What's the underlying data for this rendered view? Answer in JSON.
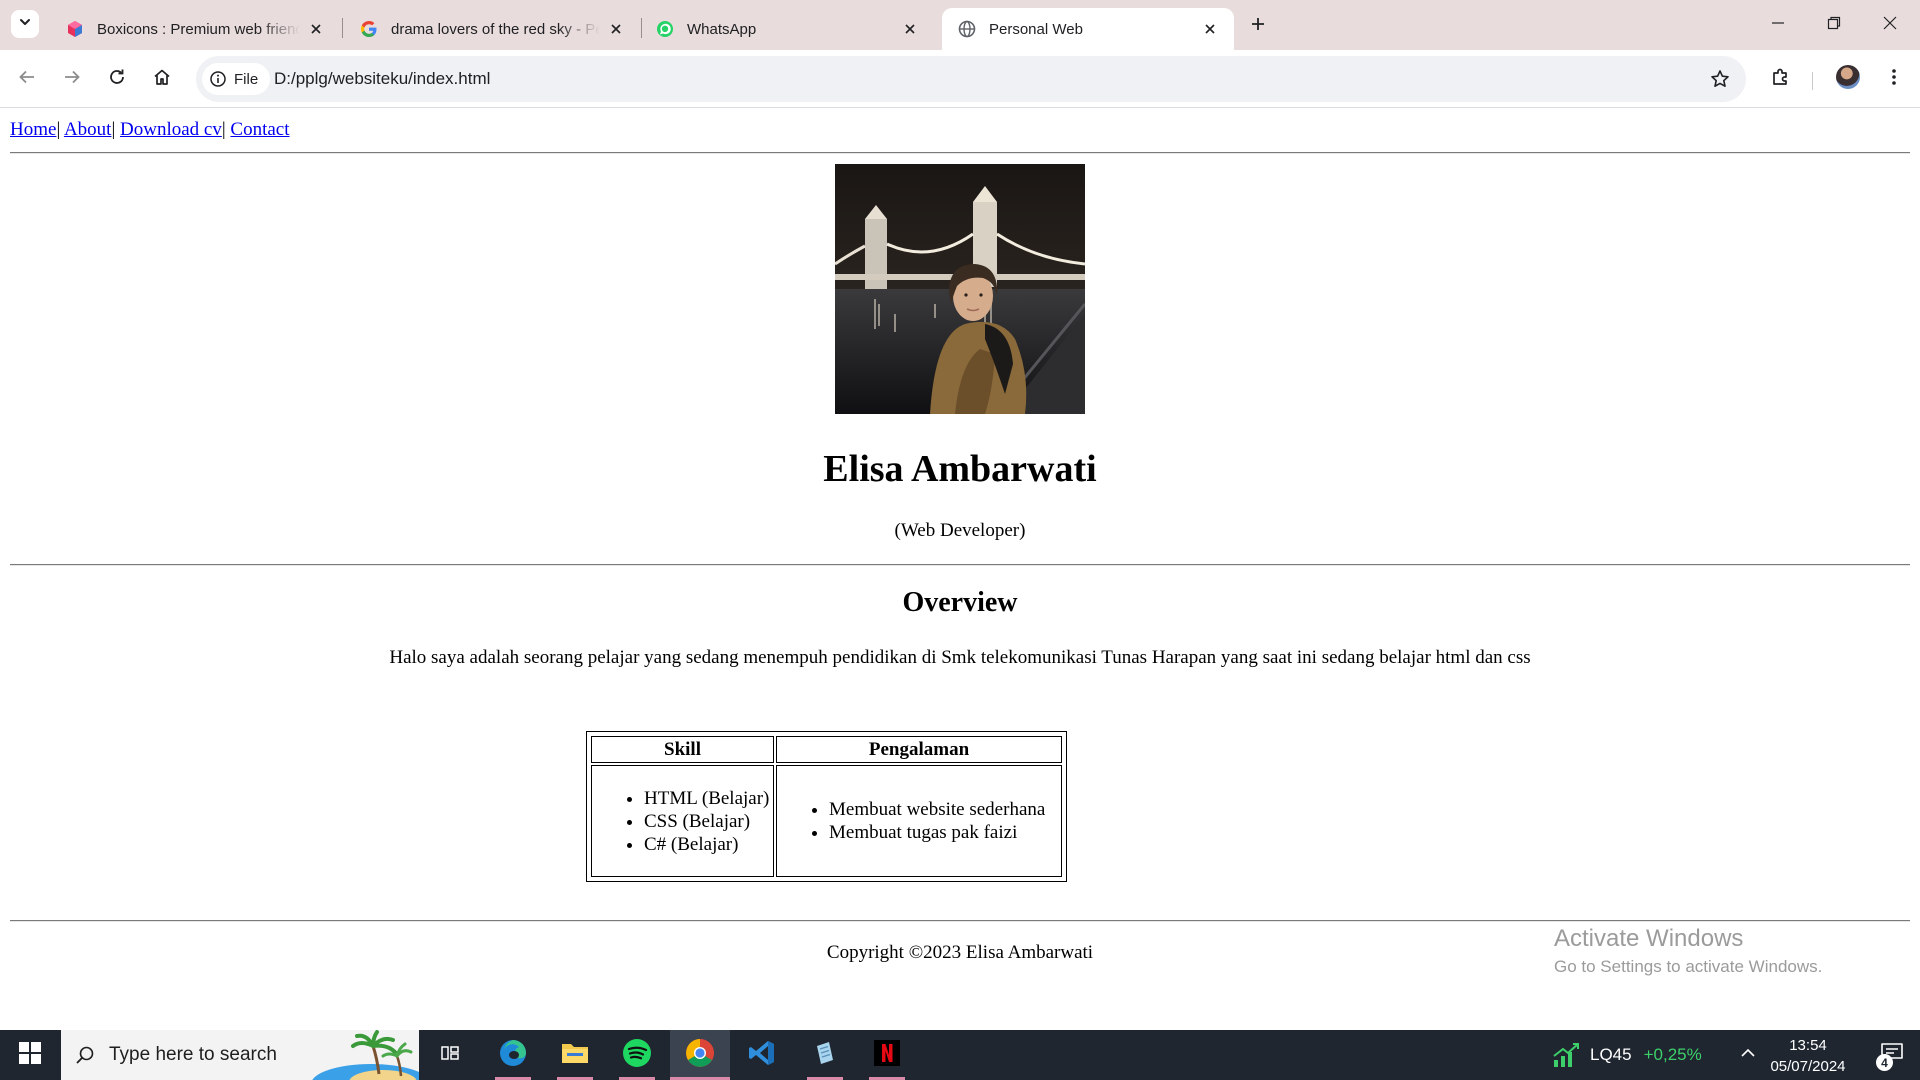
{
  "browser": {
    "tabs": [
      {
        "title": "Boxicons : Premium web friendly icons",
        "favicon": "boxicons-logo-icon",
        "active": false
      },
      {
        "title": "drama lovers of the red sky - Penelusuran Google",
        "favicon": "google-logo-icon",
        "active": false
      },
      {
        "title": "WhatsApp",
        "favicon": "whatsapp-logo-icon",
        "active": false
      },
      {
        "title": "Personal Web",
        "favicon": "globe-icon",
        "active": true
      }
    ],
    "site_chip": "File",
    "url": "D:/pplg/websiteku/index.html"
  },
  "page": {
    "nav": [
      {
        "label": "Home"
      },
      {
        "label": "About"
      },
      {
        "label": "Download cv"
      },
      {
        "label": "Contact"
      }
    ],
    "nav_separator": "|",
    "name": "Elisa Ambarwati",
    "role": "(Web Developer)",
    "overview_title": "Overview",
    "overview_text": "Halo saya adalah seorang pelajar yang sedang menempuh pendidikan di Smk telekomunikasi Tunas Harapan yang saat ini sedang belajar html dan css",
    "table": {
      "headers": [
        "Skill",
        "Pengalaman"
      ],
      "skills": [
        "HTML (Belajar)",
        "CSS (Belajar)",
        "C# (Belajar)"
      ],
      "experience": [
        "Membuat website sederhana",
        "Membuat tugas pak faizi"
      ]
    },
    "copyright": "Copyright ©2023 Elisa Ambarwati"
  },
  "watermark": {
    "line1": "Activate Windows",
    "line2": "Go to Settings to activate Windows."
  },
  "taskbar": {
    "search_placeholder": "Type here to search",
    "pinned_icons": [
      "edge-icon",
      "file-explorer-icon",
      "spotify-icon",
      "chrome-icon",
      "vscode-icon",
      "notepad-icon",
      "netflix-icon"
    ],
    "stock_symbol": "LQ45",
    "stock_change": "+0,25%",
    "time": "13:54",
    "date": "05/07/2024",
    "notification_count": "4"
  },
  "colors": {
    "tab_strip": "#e9dcdc",
    "link": "#0000ee",
    "taskbar": "#1f2630",
    "stock_up": "#3ccf6a"
  }
}
